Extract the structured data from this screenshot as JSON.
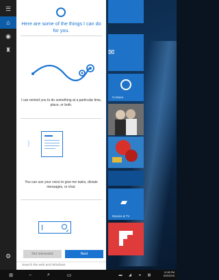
{
  "cortana": {
    "headline": "Here are some of the things I can do for you.",
    "features": [
      {
        "description": "I can remind you to do something at a particular time, place, or both."
      },
      {
        "description": "You can use your voice to give me tasks, dictate messages, or chat."
      }
    ],
    "buttons": {
      "not_interested": "Not interested",
      "next": "Next"
    },
    "search_placeholder": "Search the web and Windows"
  },
  "tiles": [
    {
      "caption": ""
    },
    {
      "caption": "Cortana"
    },
    {
      "caption": ""
    },
    {
      "caption": ""
    },
    {
      "caption": "Movies & TV"
    },
    {
      "caption": ""
    }
  ],
  "taskbar": {
    "time": "11:55 PM",
    "date": "8/30/2015"
  },
  "colors": {
    "accent": "#1a73d1",
    "rail": "#1f1f1f",
    "taskbar": "#101010"
  }
}
